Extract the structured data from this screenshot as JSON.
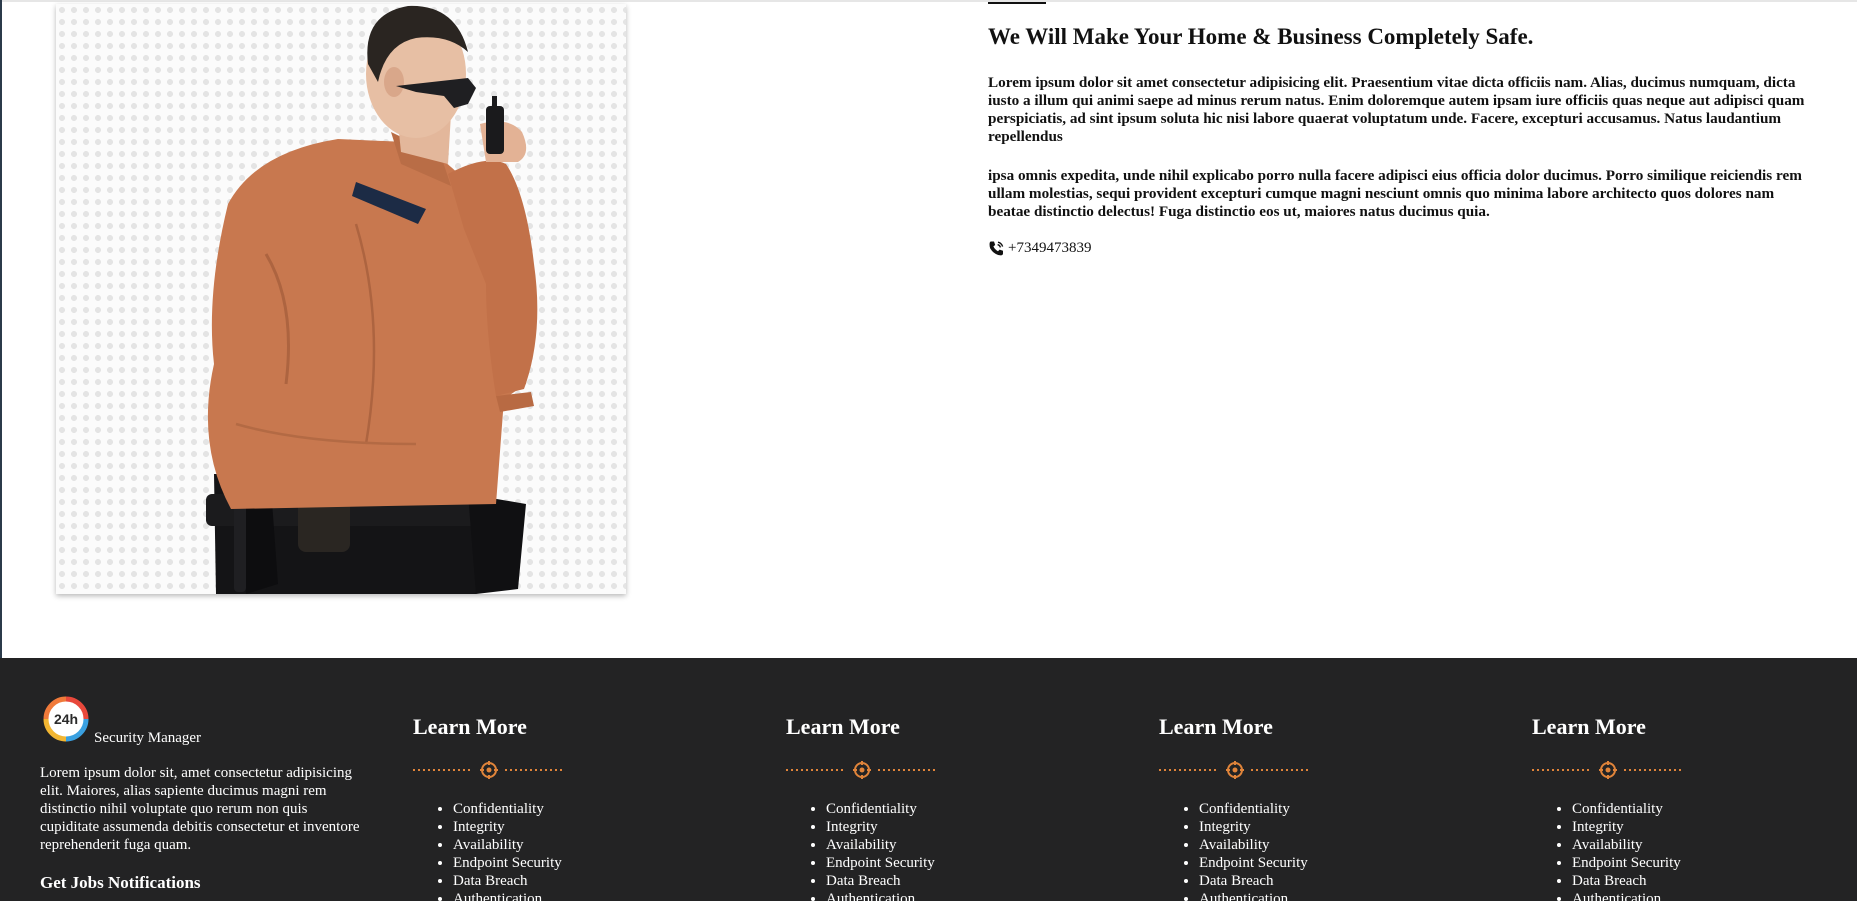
{
  "about": {
    "title": "We Will Make Your Home & Business Completely Safe.",
    "paragraph1": "Lorem ipsum dolor sit amet consectetur adipisicing elit. Praesentium vitae dicta officiis nam. Alias, ducimus numquam, dicta iusto a illum qui animi saepe ad minus rerum natus. Enim doloremque autem ipsam iure officiis quas neque aut adipisci quam perspiciatis, ad sint ipsum soluta hic nisi labore quaerat voluptatum unde. Facere, excepturi accusamus. Natus laudantium repellendus",
    "paragraph2": "ipsa omnis expedita, unde nihil explicabo porro nulla facere adipisci eius officia dolor ducimus. Porro similique reiciendis rem ullam molestias, sequi provident excepturi cumque magni nesciunt omnis quo minima labore architecto quos dolores nam beatae distinctio delectus! Fuga distinctio eos ut, maiores natus ducimus quia.",
    "phone": "+7349473839",
    "phone_icon": "phone-volume-icon"
  },
  "footer": {
    "brand": {
      "logo_text": "24h",
      "name": "Security Manager",
      "description": "Lorem ipsum dolor sit, amet consectetur adipisicing elit. Maiores, alias sapiente ducimus magni rem distinctio nihil voluptate quo rerum non quis cupiditate assumenda debitis consectetur et inventore reprehenderit fuga quam.",
      "jobs_heading": "Get Jobs Notifications"
    },
    "accent_color": "#e0843a",
    "background_color": "#232324",
    "columns": [
      {
        "title": "Learn More",
        "links": [
          "Confidentiality",
          "Integrity",
          "Availability",
          "Endpoint Security",
          "Data Breach",
          "Authentication"
        ]
      },
      {
        "title": "Learn More",
        "links": [
          "Confidentiality",
          "Integrity",
          "Availability",
          "Endpoint Security",
          "Data Breach",
          "Authentication"
        ]
      },
      {
        "title": "Learn More",
        "links": [
          "Confidentiality",
          "Integrity",
          "Availability",
          "Endpoint Security",
          "Data Breach",
          "Authentication"
        ]
      },
      {
        "title": "Learn More",
        "links": [
          "Confidentiality",
          "Integrity",
          "Availability",
          "Endpoint Security",
          "Data Breach",
          "Authentication"
        ]
      }
    ]
  }
}
